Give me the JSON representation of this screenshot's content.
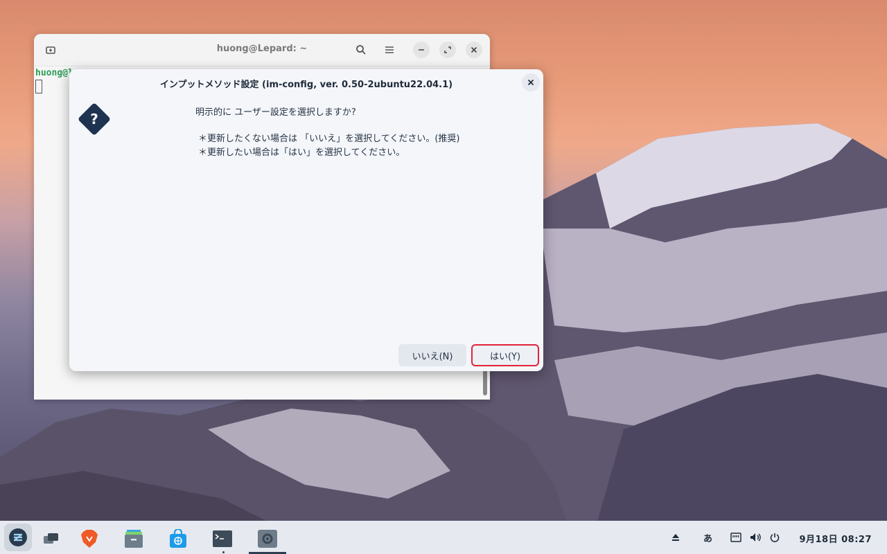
{
  "terminal": {
    "title": "huong@Lepard: ~",
    "prompt": "huong@l"
  },
  "dialog": {
    "title": "インプットメソッド設定 (im-config, ver. 0.50-2ubuntu22.04.1)",
    "question": "明示的に ユーザー設定を選択しますか?",
    "line1": "＊更新したくない場合は 「いいえ」を選択してください。(推奨)",
    "line2": "＊更新したい場合は「はい」を選択してください。",
    "no_label": "いいえ(N)",
    "yes_label": "はい(Y)"
  },
  "taskbar": {
    "ime": "あ",
    "clock": "9月18日  08:27"
  },
  "colors": {
    "highlight": "#e0233a",
    "prompt": "#2e9e57"
  }
}
